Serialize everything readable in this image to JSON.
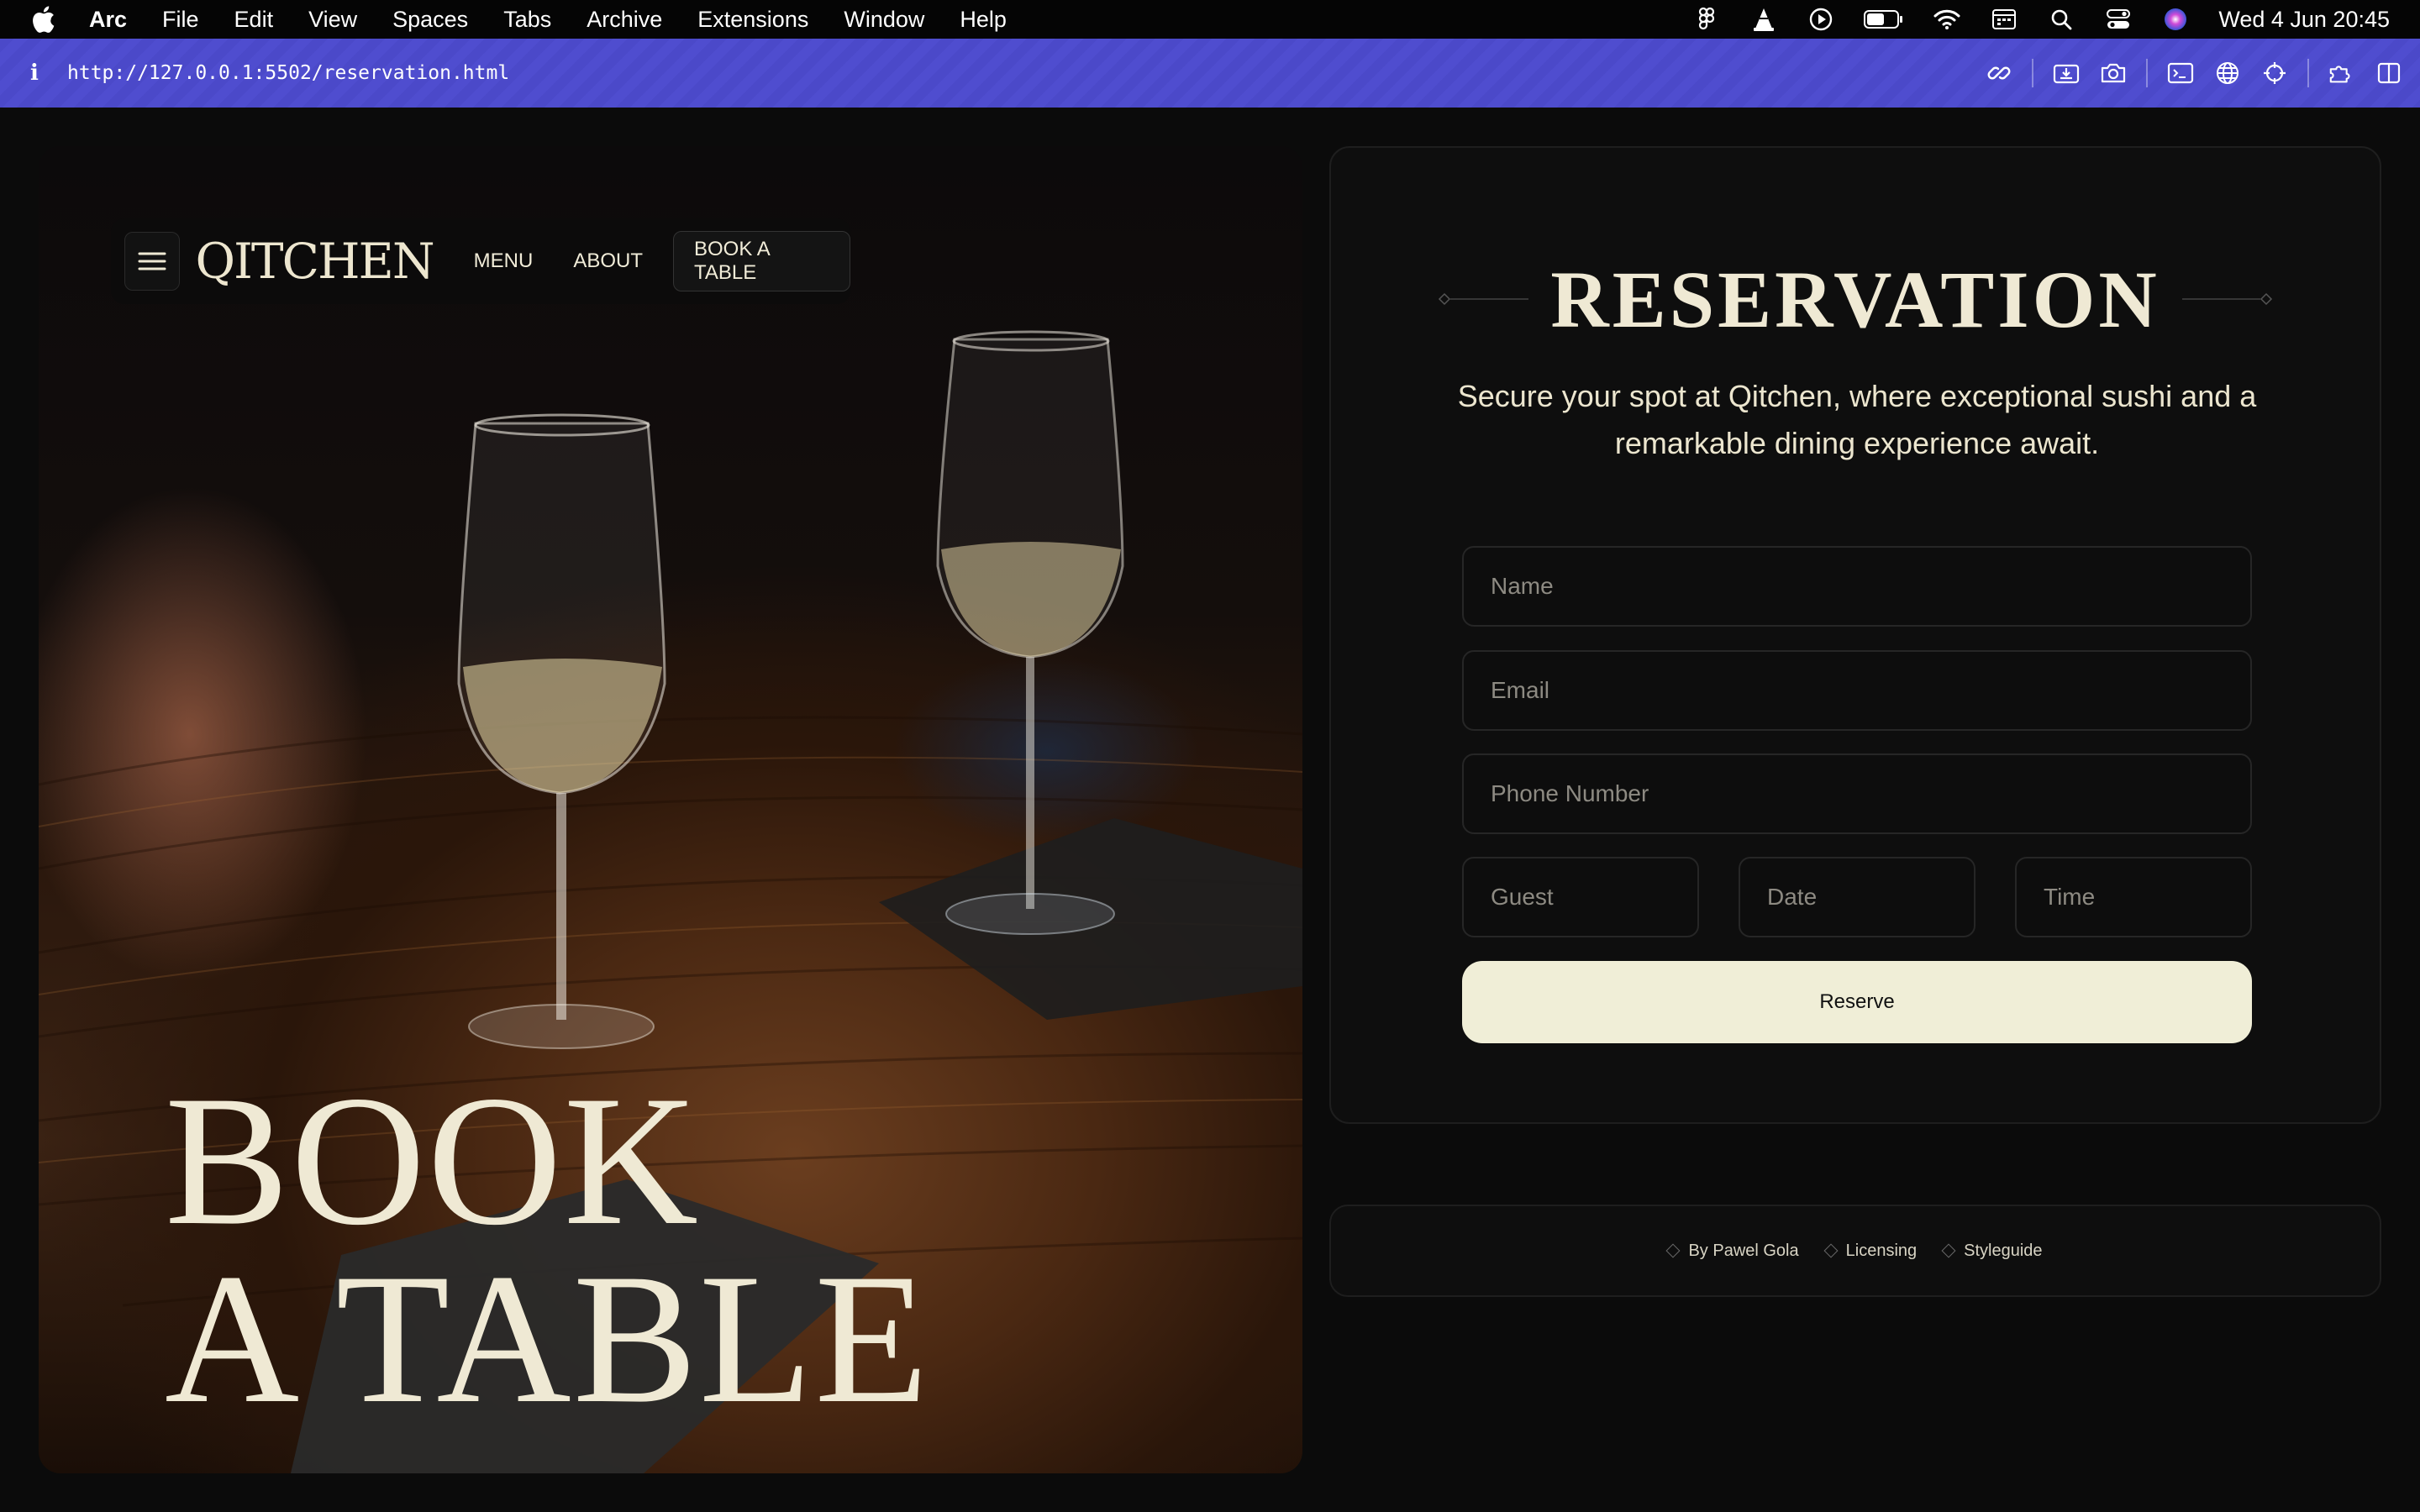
{
  "menubar": {
    "app_name": "Arc",
    "items": [
      "File",
      "Edit",
      "View",
      "Spaces",
      "Tabs",
      "Archive",
      "Extensions",
      "Window",
      "Help"
    ],
    "clock": "Wed 4 Jun  20:45"
  },
  "addressbar": {
    "url": "http://127.0.0.1:5502/reservation.html"
  },
  "hero": {
    "logo": "QITCHEN",
    "nav": {
      "menu": "MENU",
      "about": "ABOUT",
      "book": "BOOK A TABLE"
    },
    "title_line1": "BOOK",
    "title_line2": "A TABLE"
  },
  "reservation": {
    "title": "RESERVATION",
    "subtitle": "Secure your spot at Qitchen, where exceptional sushi and a remarkable dining experience await.",
    "fields": {
      "name": "Name",
      "email": "Email",
      "phone": "Phone Number",
      "guest": "Guest",
      "date": "Date",
      "time": "Time"
    },
    "submit": "Reserve"
  },
  "footer": {
    "links": [
      "By Pawel Gola",
      "Licensing",
      "Styleguide"
    ]
  },
  "colors": {
    "accent_cream": "#efe9d4",
    "button_bg": "#f0eed7",
    "address_bar": "#4b49c9",
    "background": "#0b0b0b"
  }
}
